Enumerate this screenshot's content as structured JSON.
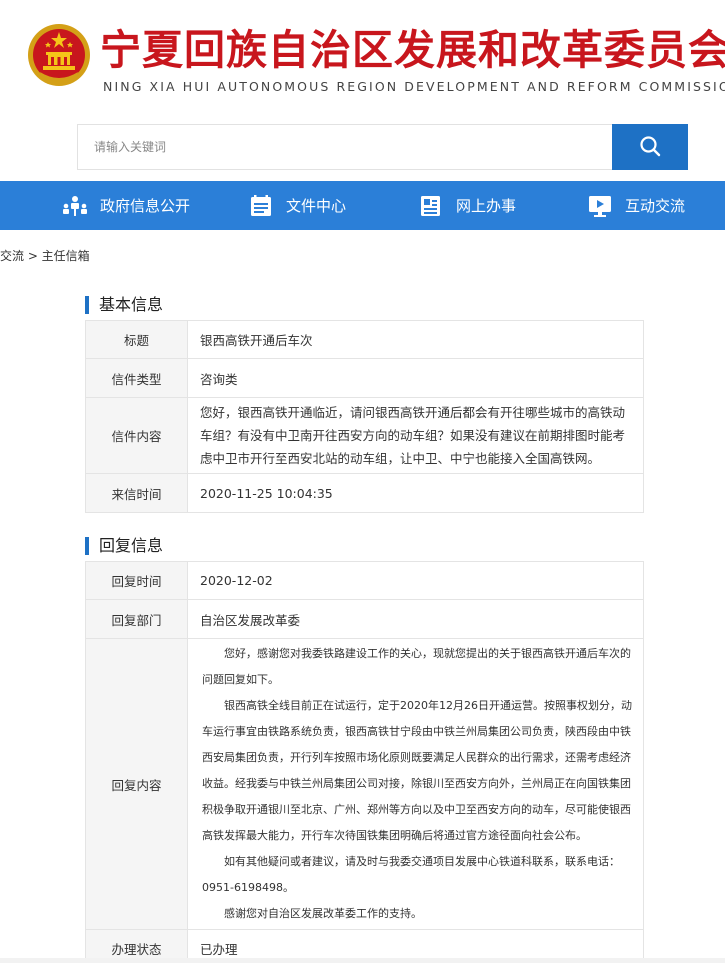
{
  "header": {
    "title_cn": "宁夏回族自治区发展和改革委员会",
    "title_en": "NING XIA HUI AUTONOMOUS REGION DEVELOPMENT AND REFORM COMMISSION",
    "emblem_icon": "national-emblem-icon",
    "brand_color": "#c8161d"
  },
  "search": {
    "placeholder": "请输入关键词",
    "button_icon": "search-icon"
  },
  "nav": {
    "color": "#2b7fd8",
    "items": [
      {
        "label": "政府信息公开",
        "icon": "people-hierarchy-icon"
      },
      {
        "label": "文件中心",
        "icon": "document-icon"
      },
      {
        "label": "网上办事",
        "icon": "online-service-icon"
      },
      {
        "label": "互动交流",
        "icon": "play-screen-icon"
      }
    ]
  },
  "breadcrumb": "交流 > 主任信箱",
  "basic": {
    "section_title": "基本信息",
    "rows": [
      {
        "label": "标题",
        "value": "银西高铁开通后车次"
      },
      {
        "label": "信件类型",
        "value": "咨询类"
      },
      {
        "label": "信件内容",
        "value": "您好，银西高铁开通临近，请问银西高铁开通后都会有开往哪些城市的高铁动车组？有没有中卫南开往西安方向的动车组？如果没有建议在前期排图时能考虑中卫市开行至西安北站的动车组，让中卫、中宁也能接入全国高铁网。"
      },
      {
        "label": "来信时间",
        "value": "2020-11-25 10:04:35"
      }
    ]
  },
  "reply": {
    "section_title": "回复信息",
    "time_label": "回复时间",
    "time_value": "2020-12-02",
    "dept_label": "回复部门",
    "dept_value": "自治区发展改革委",
    "content_label": "回复内容",
    "paragraphs": [
      "您好，感谢您对我委铁路建设工作的关心，现就您提出的关于银西高铁开通后车次的问题回复如下。",
      "银西高铁全线目前正在试运行，定于2020年12月26日开通运营。按照事权划分，动车运行事宜由铁路系统负责，银西高铁甘宁段由中铁兰州局集团公司负责，陕西段由中铁西安局集团负责，开行列车按照市场化原则既要满足人民群众的出行需求，还需考虑经济收益。经我委与中铁兰州局集团公司对接，除银川至西安方向外，兰州局正在向国铁集团积极争取开通银川至北京、广州、郑州等方向以及中卫至西安方向的动车，尽可能使银西高铁发挥最大能力，开行车次待国铁集团明确后将通过官方途径面向社会公布。",
      "如有其他疑问或者建议，请及时与我委交通项目发展中心铁道科联系，联系电话：0951-6198498。",
      "感谢您对自治区发展改革委工作的支持。"
    ],
    "status_label": "办理状态",
    "status_value": "已办理"
  }
}
